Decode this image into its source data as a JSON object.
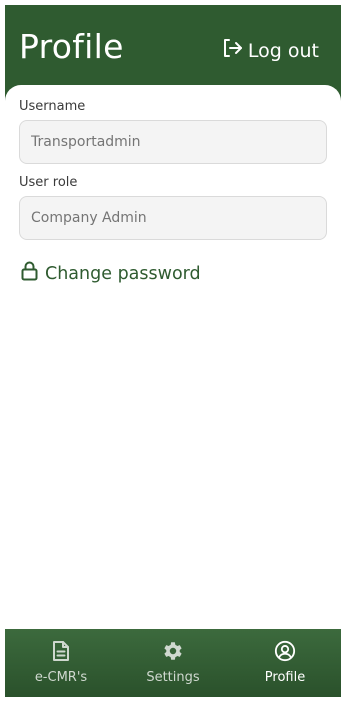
{
  "header": {
    "title": "Profile",
    "logout_label": "Log out"
  },
  "form": {
    "username": {
      "label": "Username",
      "placeholder": "Transportadmin"
    },
    "user_role": {
      "label": "User role",
      "placeholder": "Company Admin"
    },
    "change_password_label": "Change password"
  },
  "tabbar": {
    "tabs": [
      {
        "label": "e-CMR's",
        "icon": "document-icon",
        "active": false
      },
      {
        "label": "Settings",
        "icon": "gear-icon",
        "active": false
      },
      {
        "label": "Profile",
        "icon": "user-circle-icon",
        "active": true
      }
    ]
  },
  "colors": {
    "brand_green": "#2f5b30",
    "input_background": "#f4f4f4",
    "page_background": "#ffffff"
  }
}
